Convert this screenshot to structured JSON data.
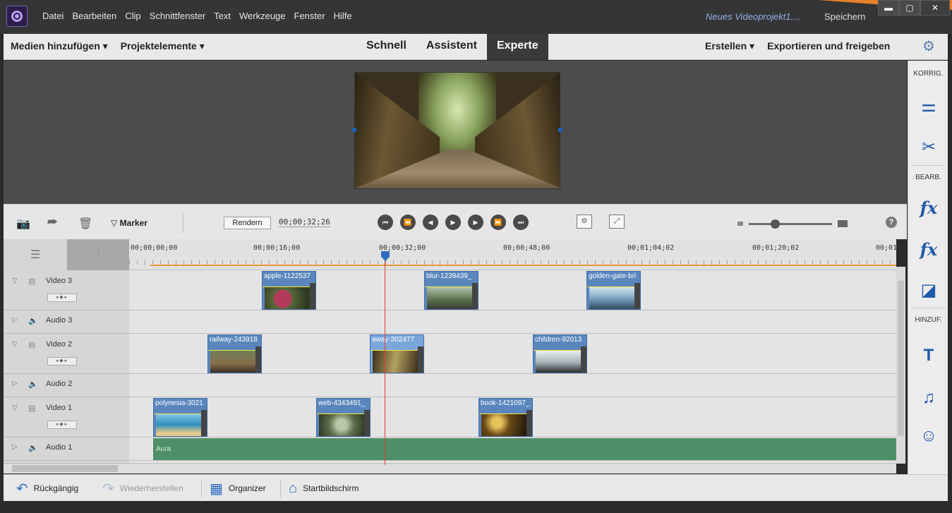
{
  "titlebar": {
    "menu": [
      "Datei",
      "Bearbeiten",
      "Clip",
      "Schnittfenster",
      "Text",
      "Werkzeuge",
      "Fenster",
      "Hilfe"
    ],
    "project_name": "Neues Videoprojekt1....",
    "save_label": "Speichern",
    "minimize": "▬",
    "maximize": "▢",
    "close": "✕"
  },
  "modebar": {
    "add_media": "Medien hinzufügen ▾",
    "project_assets": "Projektelemente ▾",
    "modes": [
      "Schnell",
      "Assistent",
      "Experte"
    ],
    "active_mode": "Experte",
    "create": "Erstellen ▾",
    "export": "Exportieren und freigeben"
  },
  "timeline_toolbar": {
    "marker_label": "Marker",
    "render_label": "Rendern",
    "current_timecode": "00;00;32;26"
  },
  "ruler": {
    "timecodes": [
      "00;00;00;00",
      "00;00;16;00",
      "00;00;32;00",
      "00;00;48;00",
      "00;01;04;02",
      "00;01;20;02",
      "00;01"
    ]
  },
  "right_panel": {
    "sections": [
      "KORRIG.",
      "BEARB.",
      "HINZUF."
    ]
  },
  "tracks": {
    "video3": {
      "name": "Video 3",
      "clips": [
        "apple-1122537",
        "blur-1239439_",
        "golden-gate-bri"
      ]
    },
    "audio3": {
      "name": "Audio 3"
    },
    "video2": {
      "name": "Video 2",
      "clips": [
        "railway-243918",
        "away-302477",
        "children-92013"
      ]
    },
    "audio2": {
      "name": "Audio 2"
    },
    "video1": {
      "name": "Video 1",
      "clips": [
        "polynesia-3021",
        "web-4343491_",
        "book-1421097_"
      ]
    },
    "audio1": {
      "name": "Audio 1",
      "clips": [
        "Aura"
      ]
    }
  },
  "bottombar": {
    "undo": "Rückgängig",
    "redo": "Wiederherstellen",
    "organizer": "Organizer",
    "home": "Startbildschirm"
  },
  "colors": {
    "accent_blue": "#2e6bbf",
    "playhead_red": "#e53b3b",
    "audio_clip_green": "#4e8f67",
    "video_clip_blue": "#5a86bd"
  }
}
